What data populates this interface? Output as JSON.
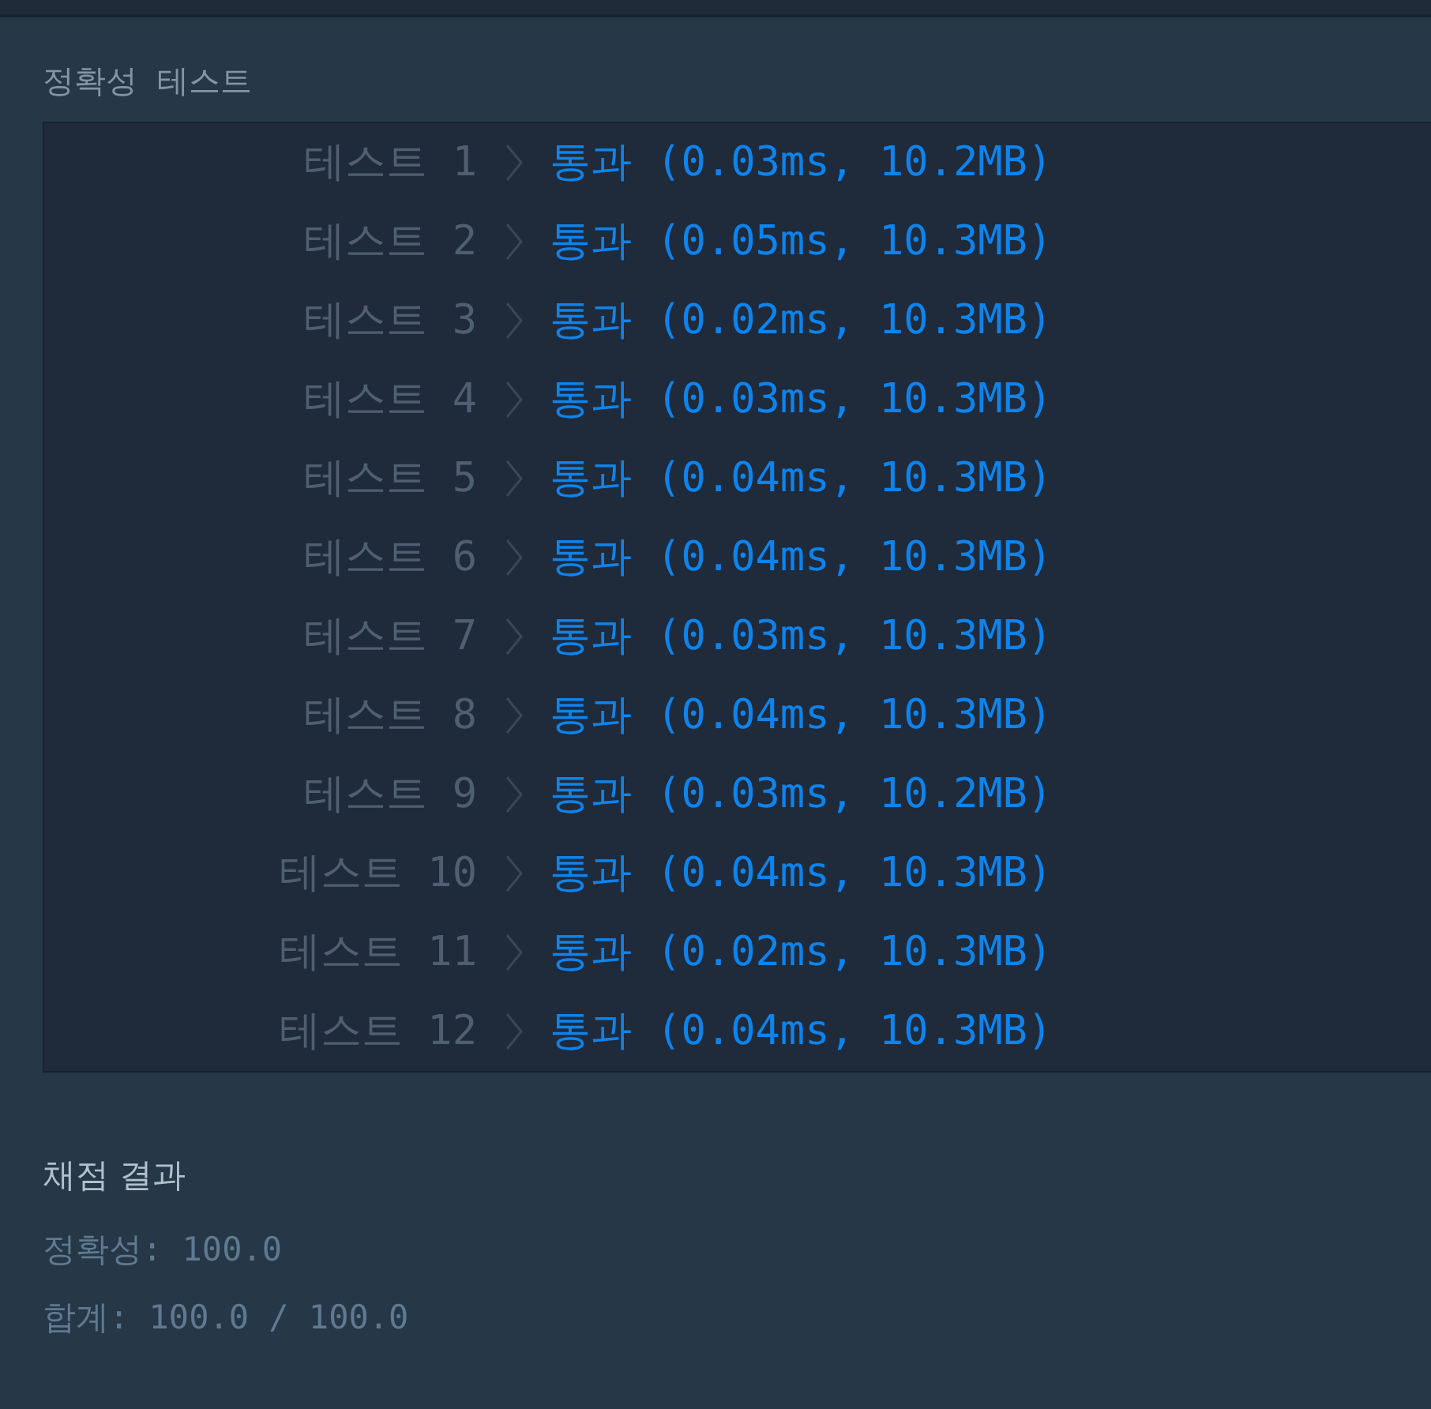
{
  "accuracy_section": {
    "title": "정확성  테스트",
    "tests": [
      {
        "label": "테스트 1",
        "result": "통과 (0.03ms, 10.2MB)",
        "kind": "pass"
      },
      {
        "label": "테스트 2",
        "result": "통과 (0.05ms, 10.3MB)",
        "kind": "pass"
      },
      {
        "label": "테스트 3",
        "result": "통과 (0.02ms, 10.3MB)",
        "kind": "pass"
      },
      {
        "label": "테스트 4",
        "result": "통과 (0.03ms, 10.3MB)",
        "kind": "pass"
      },
      {
        "label": "테스트 5",
        "result": "통과 (0.04ms, 10.3MB)",
        "kind": "pass"
      },
      {
        "label": "테스트 6",
        "result": "통과 (0.04ms, 10.3MB)",
        "kind": "pass"
      },
      {
        "label": "테스트 7",
        "result": "통과 (0.03ms, 10.3MB)",
        "kind": "pass"
      },
      {
        "label": "테스트 8",
        "result": "통과 (0.04ms, 10.3MB)",
        "kind": "pass"
      },
      {
        "label": "테스트 9",
        "result": "통과 (0.03ms, 10.2MB)",
        "kind": "pass"
      },
      {
        "label": "테스트 10",
        "result": "통과 (0.04ms, 10.3MB)",
        "kind": "pass"
      },
      {
        "label": "테스트 11",
        "result": "통과 (0.02ms, 10.3MB)",
        "kind": "pass"
      },
      {
        "label": "테스트 12",
        "result": "통과 (0.04ms, 10.3MB)",
        "kind": "pass"
      }
    ]
  },
  "grading": {
    "title": "채점 결과",
    "lines": [
      "정확성: 100.0",
      "합계: 100.0 / 100.0"
    ]
  }
}
